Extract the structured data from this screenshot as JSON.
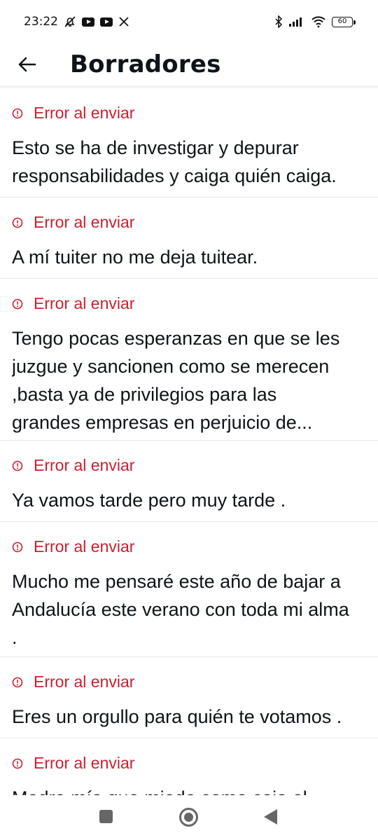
{
  "status_bar": {
    "time": "23:22",
    "battery": "60",
    "left_icons": [
      "bell-off-icon",
      "youtube-icon",
      "youtube-icon",
      "x-icon"
    ],
    "right_icons": [
      "bluetooth-icon",
      "signal-icon",
      "wifi-icon",
      "battery-icon"
    ]
  },
  "header": {
    "title": "Borradores",
    "back_icon": "arrow-left-icon"
  },
  "drafts": [
    {
      "error": "Error al enviar",
      "text": "Esto se ha de investigar y depurar responsabilidades y caiga quién caiga."
    },
    {
      "error": "Error al enviar",
      "text": "A mí tuiter no me deja tuitear."
    },
    {
      "error": "Error al enviar",
      "text": "Tengo pocas esperanzas en que se les juzgue y sancionen como se merecen ,basta ya de privilegios para las grandes empresas en perjuicio de..."
    },
    {
      "error": "Error al enviar",
      "text": "Ya vamos tarde pero muy tarde ."
    },
    {
      "error": "Error al enviar",
      "text": "Mucho me pensaré este año de bajar a Andalucía este verano con toda mi alma ."
    },
    {
      "error": "Error al enviar",
      "text": "Eres un orgullo para quién te votamos ."
    },
    {
      "error": "Error al enviar",
      "text": "Madre mía que miedo como coja el"
    }
  ],
  "colors": {
    "error": "#cc1f2f",
    "text": "#0f1419",
    "divider": "#e7e9ea"
  }
}
